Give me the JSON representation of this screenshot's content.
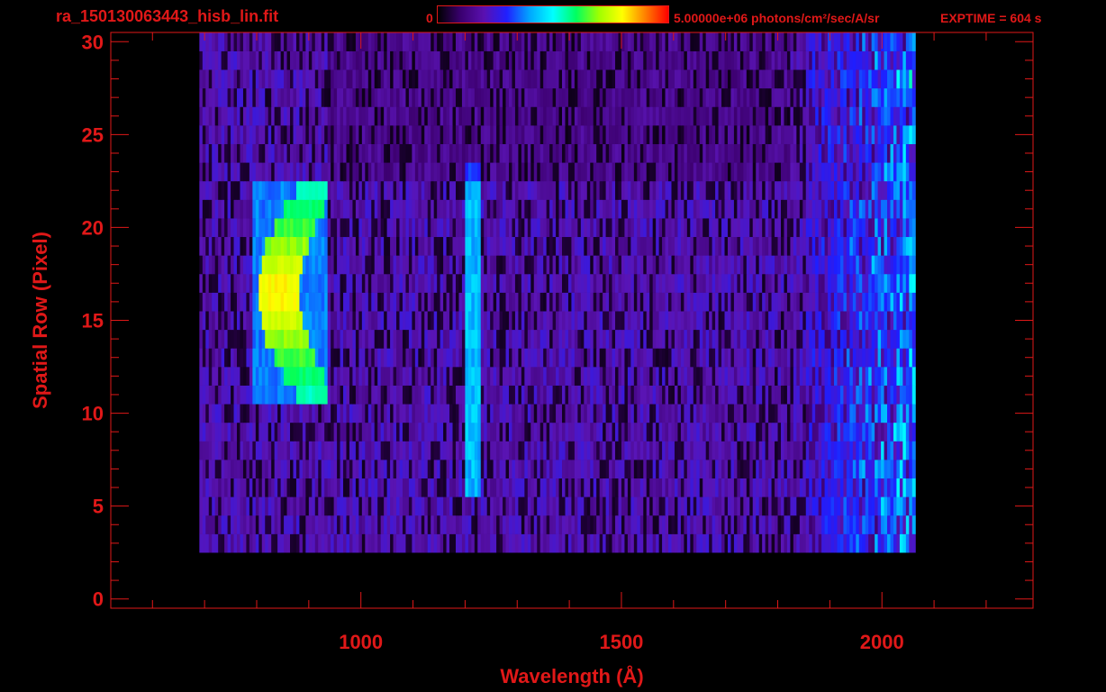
{
  "header": {
    "file_title": "ra_150130063443_hisb_lin.fit",
    "colorbar_min": "0",
    "colorbar_max": "5.00000e+06 photons/cm²/sec/A/sr",
    "exptime": "EXPTIME = 604 s",
    "colorbar_stops": [
      "#000000",
      "#3a0070",
      "#5a10b0",
      "#2020ff",
      "#00a8ff",
      "#00ffff",
      "#00ff60",
      "#a0ff00",
      "#ffff00",
      "#ff8000",
      "#ff0000"
    ]
  },
  "chart_data": {
    "type": "heatmap",
    "title": "ra_150130063443_hisb_lin.fit",
    "xlabel": "Wavelength (Å)",
    "ylabel": "Spatial Row (Pixel)",
    "xlim": [
      520,
      2290
    ],
    "ylim": [
      -0.5,
      30.5
    ],
    "x_ticks": [
      1000,
      1500,
      2000
    ],
    "y_ticks": [
      0,
      5,
      10,
      15,
      20,
      25,
      30
    ],
    "color_scale": {
      "min": 0,
      "max": 5000000,
      "units": "photons/cm²/sec/A/sr"
    },
    "data_extent": {
      "x": [
        690,
        2060
      ],
      "y": [
        3,
        30
      ]
    },
    "features": [
      {
        "x": [
          800,
          920
        ],
        "y": [
          11,
          22
        ],
        "level": "high",
        "peak_rows": [
          14,
          19
        ]
      },
      {
        "x": [
          1200,
          1220
        ],
        "y": [
          6,
          23
        ],
        "level": "medium"
      },
      {
        "x": [
          1850,
          2060
        ],
        "y": [
          3,
          30
        ],
        "level": "medium"
      }
    ],
    "colors": {
      "axis": "#e01818",
      "background": "#000000"
    }
  }
}
